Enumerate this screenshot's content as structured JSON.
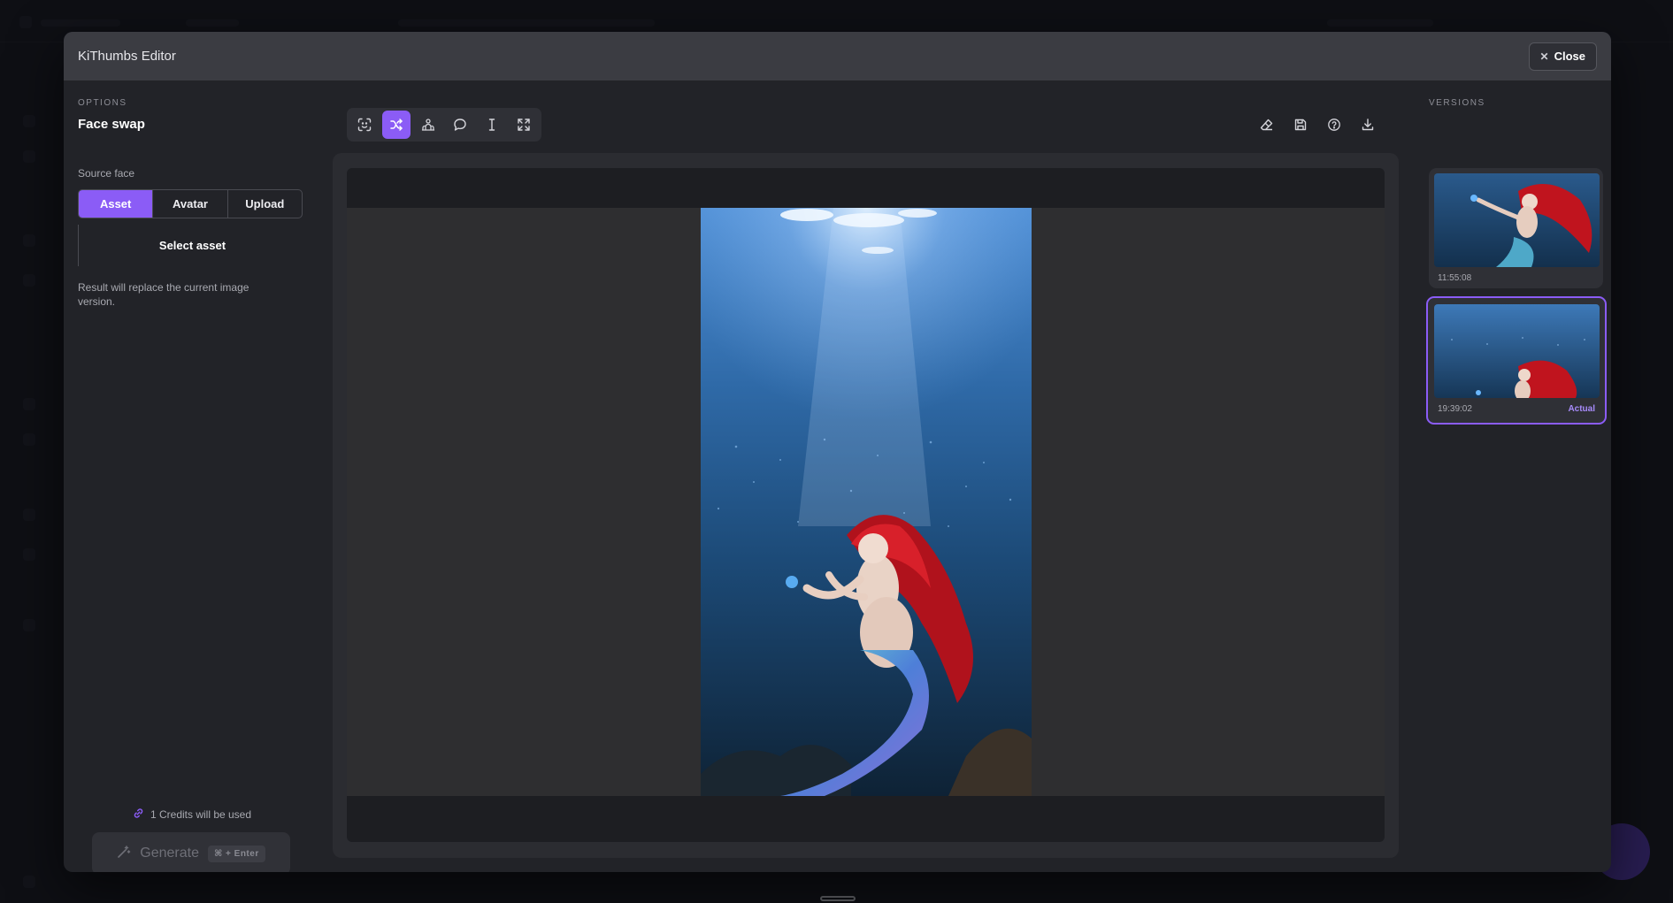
{
  "modal": {
    "title": "KiThumbs Editor",
    "close_label": "Close"
  },
  "options": {
    "eyebrow": "OPTIONS",
    "title": "Face swap",
    "source_face_label": "Source face",
    "segments": [
      "Asset",
      "Avatar",
      "Upload"
    ],
    "active_segment": "Asset",
    "select_asset_label": "Select asset",
    "note": "Result will replace the current image version.",
    "credits_text": "1 Credits will be used",
    "generate_label": "Generate",
    "generate_shortcut": "⌘ + Enter"
  },
  "toolbar": {
    "tools": [
      "face-detect-icon",
      "shuffle-icon",
      "crowd-icon",
      "speech-bubble-icon",
      "text-cursor-icon",
      "expand-icon"
    ],
    "active_tool": "shuffle-icon",
    "right_tools": [
      "eraser-icon",
      "save-icon",
      "help-icon",
      "download-icon"
    ]
  },
  "versions": {
    "eyebrow": "VERSIONS",
    "items": [
      {
        "time": "11:55:08",
        "badge": ""
      },
      {
        "time": "19:39:02",
        "badge": "Actual"
      }
    ]
  },
  "colors": {
    "accent": "#8b5cf6",
    "modal_bg": "#222328",
    "header_bg": "#3b3c42"
  }
}
